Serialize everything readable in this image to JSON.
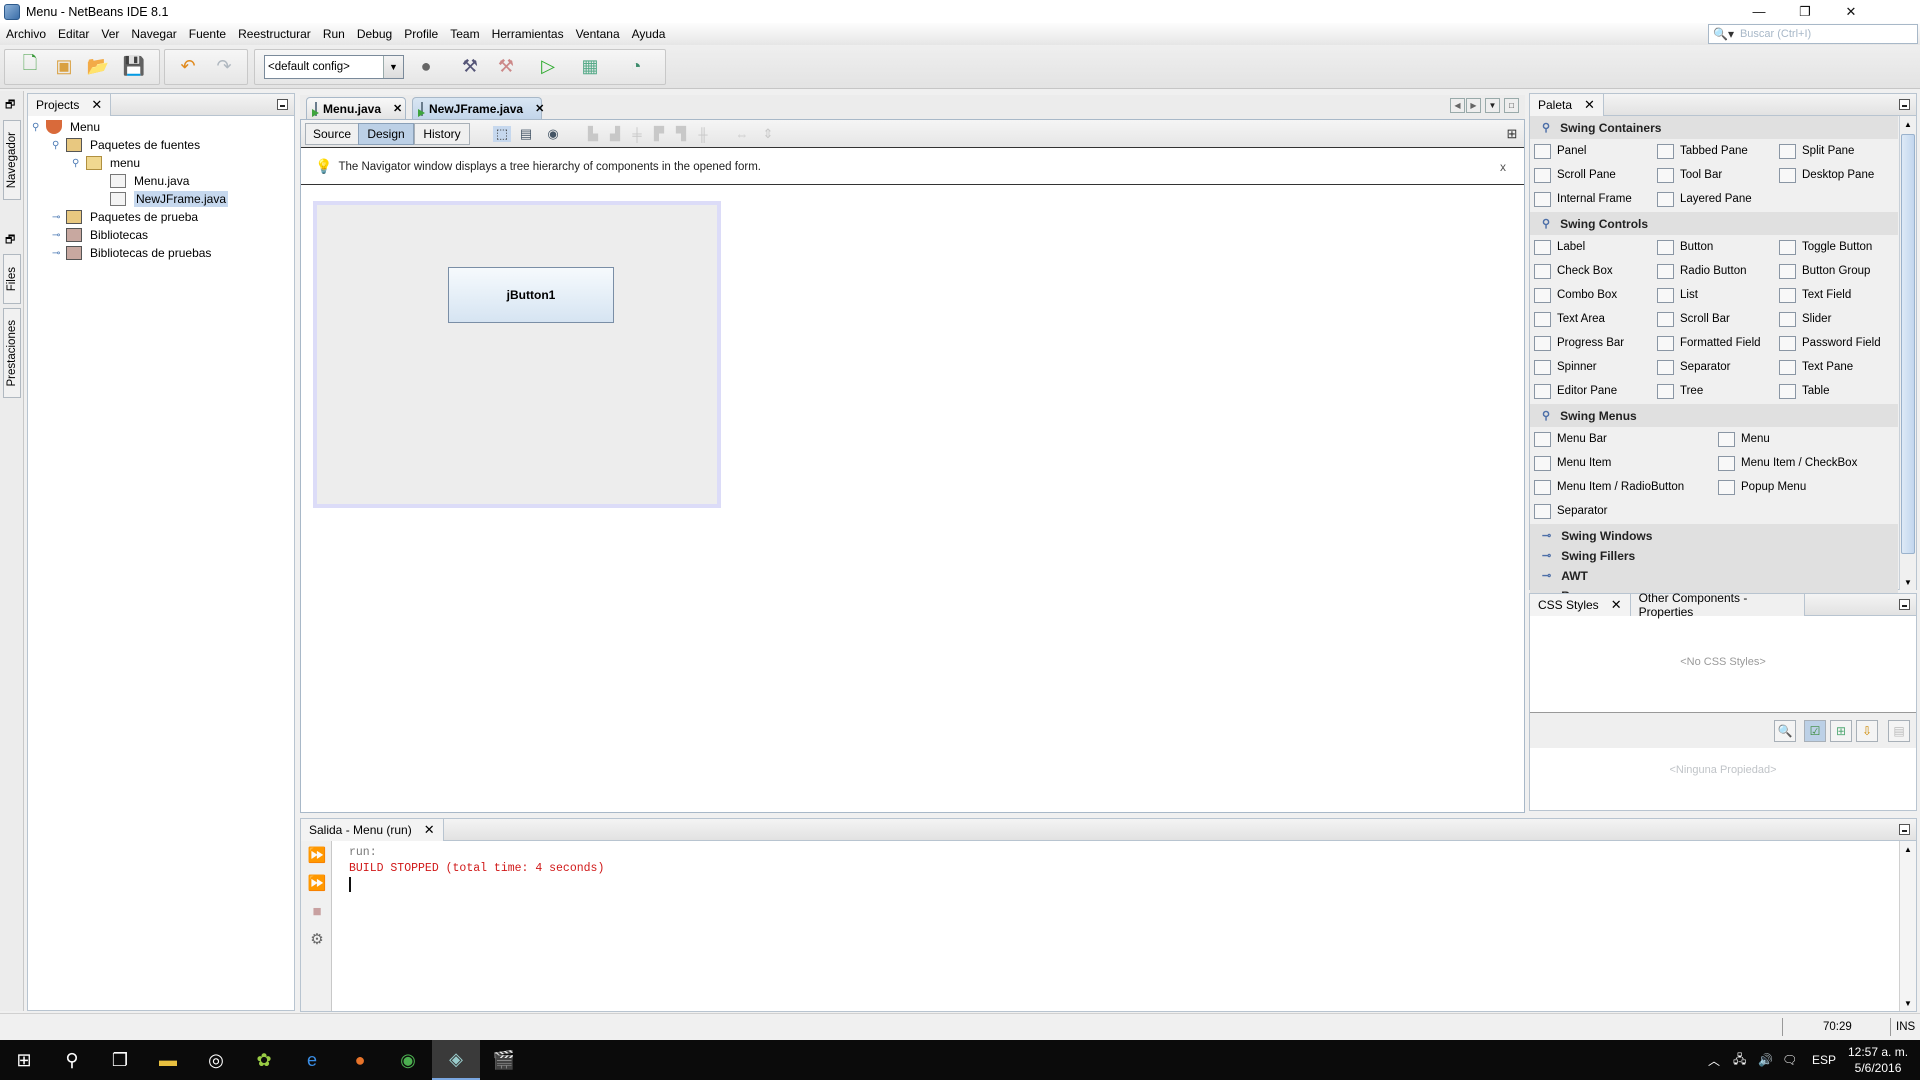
{
  "window": {
    "title": "Menu - NetBeans IDE 8.1",
    "controls": {
      "minimize": "—",
      "maximize": "❐",
      "close": "✕"
    }
  },
  "menubar": [
    "Archivo",
    "Editar",
    "Ver",
    "Navegar",
    "Fuente",
    "Reestructurar",
    "Run",
    "Debug",
    "Profile",
    "Team",
    "Herramientas",
    "Ventana",
    "Ayuda"
  ],
  "search": {
    "placeholder": "Buscar (Ctrl+I)",
    "icon": "search-icon"
  },
  "toolbar": {
    "config_value": "<default config>",
    "buttons": [
      "new-file-icon",
      "new-project-icon",
      "open-project-icon",
      "save-all-icon",
      "undo-icon",
      "redo-icon",
      "globe-icon",
      "build-icon",
      "clean-build-icon",
      "run-icon",
      "debug-icon",
      "profile-icon"
    ]
  },
  "left_strip": {
    "tabs": [
      "Navegador",
      "Files",
      "Prestaciones"
    ]
  },
  "projects": {
    "tab_label": "Projects",
    "tree": [
      {
        "label": "Menu",
        "level": 0,
        "icon": "project-coffee-icon",
        "expanded": true
      },
      {
        "label": "Paquetes de fuentes",
        "level": 1,
        "icon": "source-packages-icon",
        "expanded": true
      },
      {
        "label": "menu",
        "level": 2,
        "icon": "package-icon",
        "expanded": true
      },
      {
        "label": "Menu.java",
        "level": 3,
        "icon": "java-class-icon"
      },
      {
        "label": "NewJFrame.java",
        "level": 3,
        "icon": "jframe-form-icon",
        "selected": true
      },
      {
        "label": "Paquetes de prueba",
        "level": 1,
        "icon": "test-packages-icon",
        "expanded": false
      },
      {
        "label": "Bibliotecas",
        "level": 1,
        "icon": "libraries-icon",
        "expanded": false
      },
      {
        "label": "Bibliotecas de pruebas",
        "level": 1,
        "icon": "test-libraries-icon",
        "expanded": false
      }
    ]
  },
  "editor": {
    "tabs": [
      {
        "label": "Menu.java",
        "active": false
      },
      {
        "label": "NewJFrame.java",
        "active": true
      }
    ],
    "view_buttons": [
      "Source",
      "Design",
      "History"
    ],
    "active_view": "Design",
    "hint": "The Navigator window displays a tree hierarchy of components in the opened form.",
    "form_button_label": "jButton1"
  },
  "palette": {
    "tab_label": "Paleta",
    "categories": [
      {
        "name": "Swing Containers",
        "expanded": true,
        "columns": 3,
        "items": [
          "Panel",
          "Tabbed Pane",
          "Split Pane",
          "Scroll Pane",
          "Tool Bar",
          "Desktop Pane",
          "Internal Frame",
          "Layered Pane"
        ]
      },
      {
        "name": "Swing Controls",
        "expanded": true,
        "columns": 3,
        "items": [
          "Label",
          "Button",
          "Toggle Button",
          "Check Box",
          "Radio Button",
          "Button Group",
          "Combo Box",
          "List",
          "Text Field",
          "Text Area",
          "Scroll Bar",
          "Slider",
          "Progress Bar",
          "Formatted Field",
          "Password Field",
          "Spinner",
          "Separator",
          "Text Pane",
          "Editor Pane",
          "Tree",
          "Table"
        ]
      },
      {
        "name": "Swing Menus",
        "expanded": true,
        "columns": 2,
        "items": [
          "Menu Bar",
          "Menu",
          "Menu Item",
          "Menu Item / CheckBox",
          "Menu Item / RadioButton",
          "Popup Menu",
          "Separator"
        ]
      },
      {
        "name": "Swing Windows",
        "expanded": false,
        "items": []
      },
      {
        "name": "Swing Fillers",
        "expanded": false,
        "items": []
      },
      {
        "name": "AWT",
        "expanded": false,
        "items": []
      },
      {
        "name": "Beans",
        "expanded": false,
        "items": []
      }
    ]
  },
  "css_panel": {
    "tabs": [
      "CSS Styles",
      "Other Components - Properties"
    ],
    "empty_styles": "<No CSS Styles>",
    "empty_properties": "<Ninguna Propiedad>"
  },
  "output": {
    "tab_label": "Salida - Menu (run)",
    "lines": [
      {
        "text": "run:",
        "type": "info"
      },
      {
        "text": "BUILD STOPPED (total time: 4 seconds)",
        "type": "error"
      }
    ]
  },
  "statusbar": {
    "position": "70:29",
    "mode": "INS"
  },
  "taskbar": {
    "tray": {
      "language": "ESP",
      "time": "12:57 a. m.",
      "date": "5/6/2016"
    }
  },
  "colors": {
    "error_text": "#d01818",
    "selection": "#c6d8ee",
    "active_tab": "#c2d5ea"
  }
}
